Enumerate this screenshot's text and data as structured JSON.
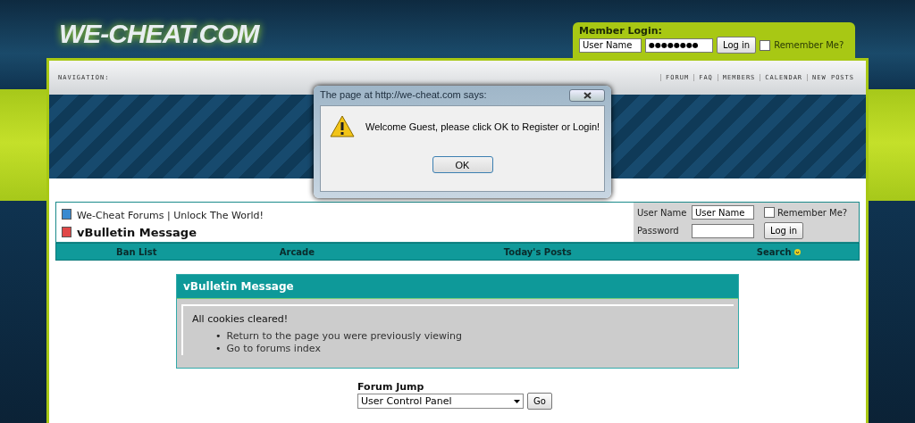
{
  "header": {
    "logo": "WE-CHEAT.COM",
    "member_login": {
      "title": "Member Login:",
      "username": "User Name",
      "password": "●●●●●●●●",
      "button": "Log in",
      "remember": {
        "label": "Remember Me?",
        "checked": false
      }
    }
  },
  "navigation": {
    "label": "NAVIGATION:",
    "links": [
      "FORUM",
      "FAQ",
      "MEMBERS",
      "CALENDAR",
      "NEW POSTS"
    ]
  },
  "dialog": {
    "title": "The page at http://we-cheat.com says:",
    "message": "Welcome Guest, please click OK to Register or Login!",
    "button": "OK"
  },
  "breadcrumb": {
    "forum": "We-Cheat Forums | Unlock The World!",
    "current": "vBulletin Message"
  },
  "login": {
    "username_label": "User Name",
    "username": "User Name",
    "password_label": "Password",
    "remember": {
      "label": "Remember Me?",
      "checked": false
    },
    "button": "Log in"
  },
  "tabs": [
    {
      "label": "Ban List",
      "menu": false
    },
    {
      "label": "Arcade",
      "menu": false
    },
    {
      "label": "Today's Posts",
      "menu": false
    },
    {
      "label": "Search",
      "menu": true
    }
  ],
  "message": {
    "title": "vBulletin Message",
    "text": "All cookies cleared!",
    "bullet": "•",
    "links": [
      "Return to the page you were previously viewing",
      "Go to forums index"
    ]
  },
  "forum_jump": {
    "label": "Forum Jump",
    "value": "User Control Panel",
    "button": "Go"
  }
}
